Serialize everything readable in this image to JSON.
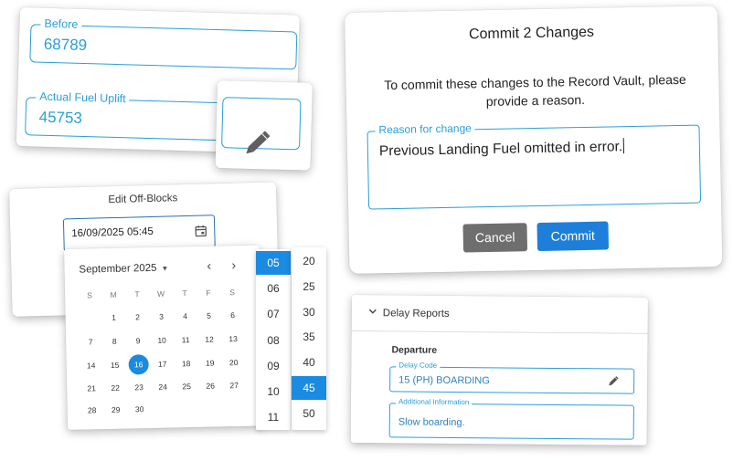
{
  "fuel": {
    "before_label": "Before",
    "before_value": "68789",
    "uplift_label": "Actual Fuel Uplift",
    "uplift_value": "45753"
  },
  "edit": {
    "icon": "pencil-icon"
  },
  "commit": {
    "title": "Commit 2 Changes",
    "message": "To commit these changes to the Record Vault, please provide a reason.",
    "reason_label": "Reason for change",
    "reason_value": "Previous Landing Fuel omitted in error.",
    "cancel_label": "Cancel",
    "commit_label": "Commit"
  },
  "offblocks": {
    "title": "Edit Off-Blocks",
    "value": "16/09/2025 05:45"
  },
  "calendar": {
    "month": "September 2025",
    "weekdays": [
      "S",
      "M",
      "T",
      "W",
      "T",
      "F",
      "S"
    ],
    "weeks": [
      [
        "",
        "1",
        "2",
        "3",
        "4",
        "5",
        "6"
      ],
      [
        "7",
        "8",
        "9",
        "10",
        "11",
        "12",
        "13"
      ],
      [
        "14",
        "15",
        "16",
        "17",
        "18",
        "19",
        "20"
      ],
      [
        "21",
        "22",
        "23",
        "24",
        "25",
        "26",
        "27"
      ],
      [
        "28",
        "29",
        "30",
        "",
        "",
        "",
        ""
      ]
    ],
    "selected_day": "16"
  },
  "time": {
    "hours": [
      "05",
      "06",
      "07",
      "08",
      "09",
      "10",
      "11"
    ],
    "selected_hour": "05",
    "minutes": [
      "20",
      "25",
      "30",
      "35",
      "40",
      "45",
      "50"
    ],
    "selected_minute": "45"
  },
  "delay": {
    "title": "Delay Reports",
    "section": "Departure",
    "code_label": "Delay Code",
    "code_value": "15 (PH) BOARDING",
    "info_label": "Additional Information",
    "info_value": "Slow boarding."
  },
  "colors": {
    "accent": "#2a9fd6",
    "primary_button": "#1d7fd9",
    "cancel_button": "#6e6e6e",
    "selected": "#1a8be0"
  }
}
